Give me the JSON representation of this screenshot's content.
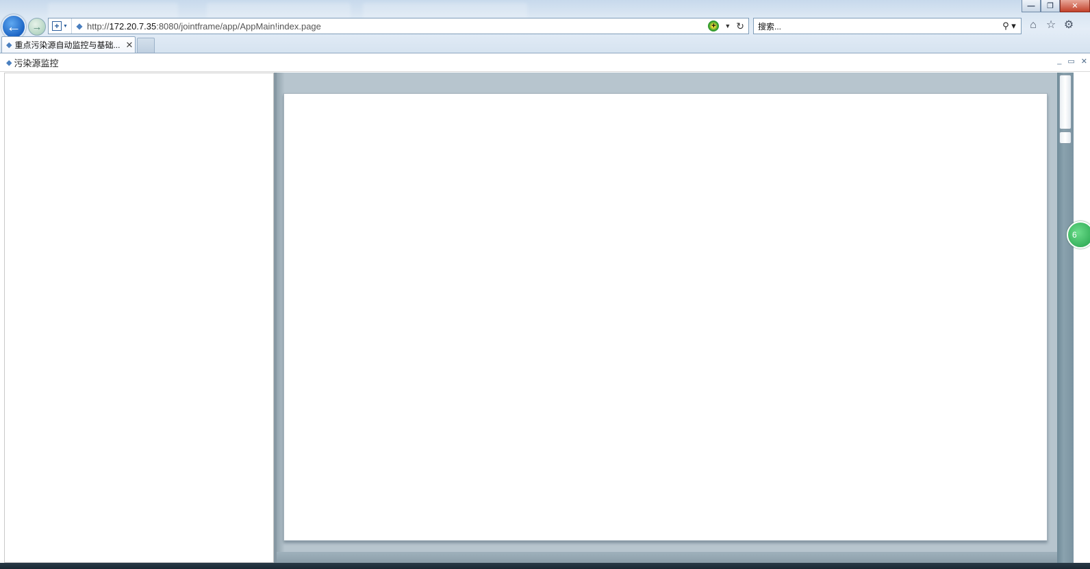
{
  "browser": {
    "background_tabs": [
      "",
      "",
      ""
    ],
    "address": {
      "url_prefix": "http://",
      "url_host": "172.20.7.35",
      "url_rest": ":8080/jointframe/app/AppMain!index.page"
    },
    "search": {
      "placeholder": "搜索..."
    },
    "active_tab": {
      "title": "重点污染源自动监控与基础..."
    },
    "window_controls": {
      "minimize": "—",
      "restore": "❐",
      "close": "✕"
    }
  },
  "app": {
    "title": "污染源监控",
    "controls": {
      "minimize": "_",
      "restore": "▭",
      "close": "✕"
    }
  },
  "badge": {
    "label": "6"
  },
  "colors": {
    "chrome": "#dbe7f3",
    "back_button": "#1c64c4",
    "content_background": "#b7c5ce",
    "badge": "#22a04a"
  }
}
